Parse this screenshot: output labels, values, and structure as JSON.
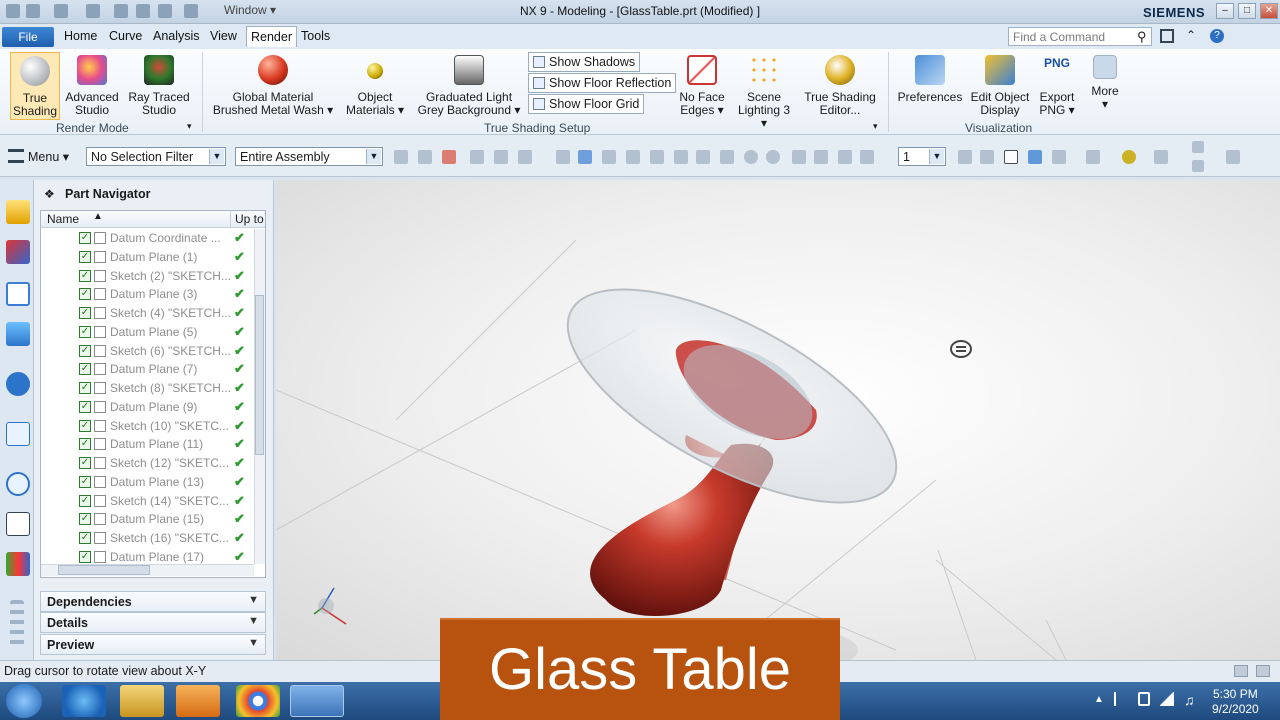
{
  "window": {
    "menu": "Window",
    "title": "NX 9 - Modeling - [GlassTable.prt (Modified) ]",
    "brand": "SIEMENS",
    "controls": [
      "–",
      "□",
      "✕"
    ]
  },
  "tabs": {
    "file": "File",
    "items": [
      "Home",
      "Curve",
      "Analysis",
      "View",
      "Render",
      "Tools"
    ],
    "active": "Render",
    "command_placeholder": "Find a Command"
  },
  "ribbon": {
    "true_shading": "True Shading",
    "advanced_studio": "Advanced Studio",
    "ray_traced_studio": "Ray Traced Studio",
    "group_render_mode": "Render Mode",
    "global_material_l1": "Global Material",
    "global_material_l2": "Brushed Metal Wash ▾",
    "object_materials": "Object Materials ▾",
    "graduated_light_l1": "Graduated Light",
    "graduated_light_l2": "Grey Background ▾",
    "show_shadows": "Show Shadows",
    "show_floor_reflection": "Show Floor Reflection",
    "show_floor_grid": "Show Floor Grid",
    "no_face_edges": "No Face Edges ▾",
    "scene_lighting": "Scene Lighting 3 ▾",
    "true_shading_editor": "True Shading Editor...",
    "group_true_shading_setup": "True Shading Setup",
    "preferences": "Preferences",
    "edit_object_display": "Edit Object Display",
    "export_png_icon": "PNG",
    "export_png": "Export PNG ▾",
    "more": "More",
    "group_visualization": "Visualization"
  },
  "toolbar": {
    "menu": "Menu ▾",
    "selection_filter": "No Selection Filter",
    "assembly_scope": "Entire Assembly",
    "layer": "1"
  },
  "navigator": {
    "title": "Part Navigator",
    "col_name": "Name",
    "col_uptodate": "Up to",
    "rows": [
      "Datum Coordinate ...",
      "Datum Plane (1)",
      "Sketch (2) \"SKETCH...",
      "Datum Plane (3)",
      "Sketch (4) \"SKETCH...",
      "Datum Plane (5)",
      "Sketch (6) \"SKETCH...",
      "Datum Plane (7)",
      "Sketch (8) \"SKETCH...",
      "Datum Plane (9)",
      "Sketch (10) \"SKETC...",
      "Datum Plane (11)",
      "Sketch (12) \"SKETC...",
      "Datum Plane (13)",
      "Sketch (14) \"SKETC...",
      "Datum Plane (15)",
      "Sketch (16) \"SKETC...",
      "Datum Plane (17)"
    ],
    "dependencies": "Dependencies",
    "details": "Details",
    "preview": "Preview"
  },
  "status": "Drag cursor to rotate view about X-Y",
  "clock": {
    "time": "5:30 PM",
    "date": "9/2/2020"
  },
  "banner": "Glass Table",
  "colors": {
    "accent": "#1f5fae",
    "banner": "#b7520f",
    "table_red": "#b4271d"
  }
}
